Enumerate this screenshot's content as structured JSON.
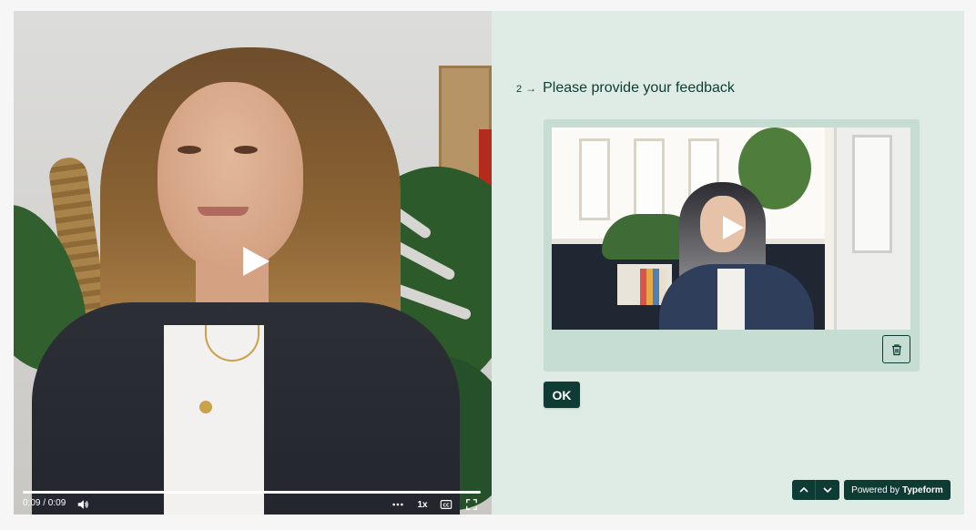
{
  "left_video": {
    "time": "0:09 / 0:09",
    "speed": "1x",
    "progress": 1.0,
    "icons": {
      "play": "play-icon",
      "volume": "volume-icon",
      "more": "more-icon",
      "captions": "captions-icon",
      "fullscreen": "fullscreen-icon"
    }
  },
  "question": {
    "number": "2",
    "arrow": "→",
    "title": "Please provide your feedback"
  },
  "recorded_video": {
    "icons": {
      "play": "play-icon",
      "delete": "trash-icon"
    }
  },
  "ok_button": {
    "label": "OK"
  },
  "footer": {
    "powered_prefix": "Powered by",
    "powered_brand": "Typeform",
    "nav_icons": {
      "up": "chevron-up-icon",
      "down": "chevron-down-icon"
    }
  },
  "colors": {
    "panel_bg": "#dfece6",
    "accent": "#0e3b33",
    "card_bg": "#c6ddd4",
    "page_bg": "#f6f6f6"
  }
}
